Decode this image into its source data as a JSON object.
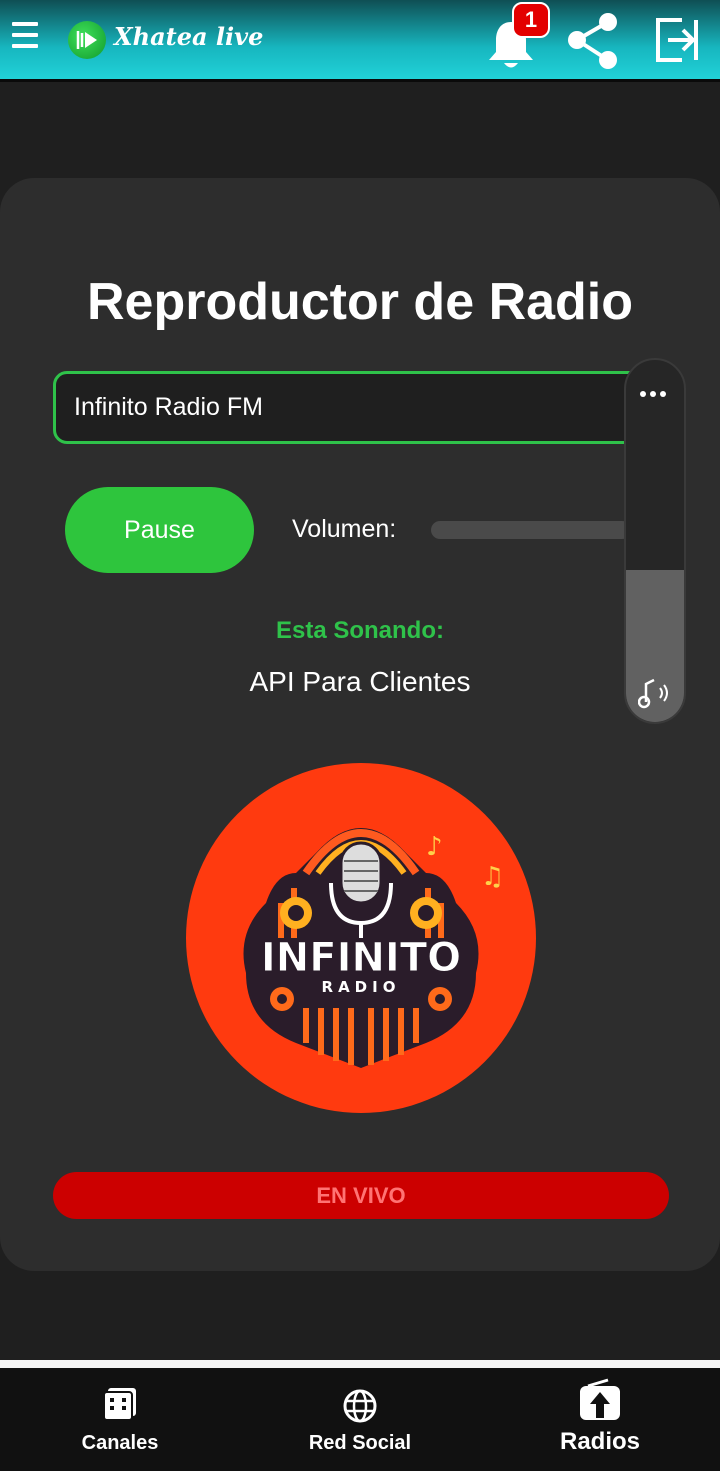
{
  "header": {
    "app_title": "Xhatea live",
    "notification_count": "1",
    "icons": [
      "menu-icon",
      "bell-icon",
      "share-icon",
      "logout-icon"
    ]
  },
  "player": {
    "title": "Reproductor de Radio",
    "station_selected": "Infinito Radio FM",
    "pause_label": "Pause",
    "volume_label": "Volumen:",
    "now_playing_label": "Esta Sonando:",
    "now_playing_song": "API Para Clientes",
    "logo_text": "INFINITO",
    "logo_subtext": "RADIO",
    "live_label": "EN VIVO"
  },
  "volume_overlay": {
    "level": 0.42
  },
  "bottom_nav": {
    "items": [
      {
        "label": "Canales",
        "icon": "channels-icon"
      },
      {
        "label": "Red Social",
        "icon": "globe-icon"
      },
      {
        "label": "Radios",
        "icon": "radio-icon"
      }
    ]
  },
  "colors": {
    "accent_green": "#2ec53d",
    "live_red": "#cc0000",
    "logo_bg": "#ff3a0f"
  }
}
